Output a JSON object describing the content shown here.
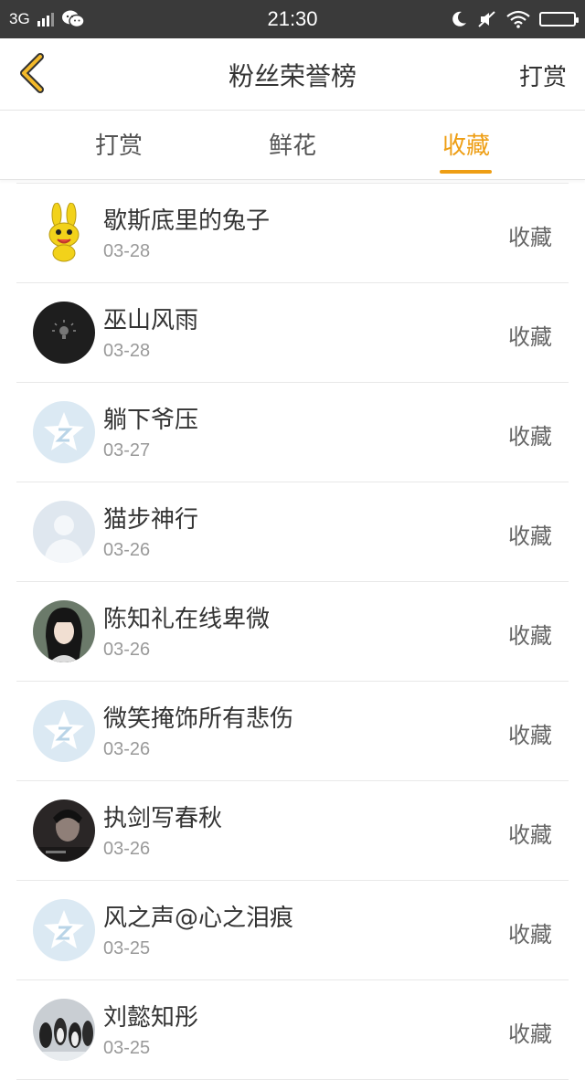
{
  "status_bar": {
    "network": "3G",
    "time": "21:30"
  },
  "header": {
    "title": "粉丝荣誉榜",
    "right_button": "打赏"
  },
  "tabs": [
    {
      "label": "打赏",
      "active": false
    },
    {
      "label": "鲜花",
      "active": false
    },
    {
      "label": "收藏",
      "active": true
    }
  ],
  "accent_color": "#ee9e14",
  "list": [
    {
      "name": "歇斯底里的兔子",
      "date": "03-28",
      "action": "收藏",
      "avatar": "yellow-bunny"
    },
    {
      "name": "巫山风雨",
      "date": "03-28",
      "action": "收藏",
      "avatar": "dark-bulb"
    },
    {
      "name": "躺下爷压",
      "date": "03-27",
      "action": "收藏",
      "avatar": "default-star"
    },
    {
      "name": "猫步神行",
      "date": "03-26",
      "action": "收藏",
      "avatar": "default-person"
    },
    {
      "name": "陈知礼在线卑微",
      "date": "03-26",
      "action": "收藏",
      "avatar": "photo-girl"
    },
    {
      "name": "微笑掩饰所有悲伤",
      "date": "03-26",
      "action": "收藏",
      "avatar": "default-star"
    },
    {
      "name": "执剑写春秋",
      "date": "03-26",
      "action": "收藏",
      "avatar": "photo-dark"
    },
    {
      "name": "风之声@心之泪痕",
      "date": "03-25",
      "action": "收藏",
      "avatar": "default-star"
    },
    {
      "name": "刘懿知彤",
      "date": "03-25",
      "action": "收藏",
      "avatar": "photo-penguins"
    }
  ]
}
